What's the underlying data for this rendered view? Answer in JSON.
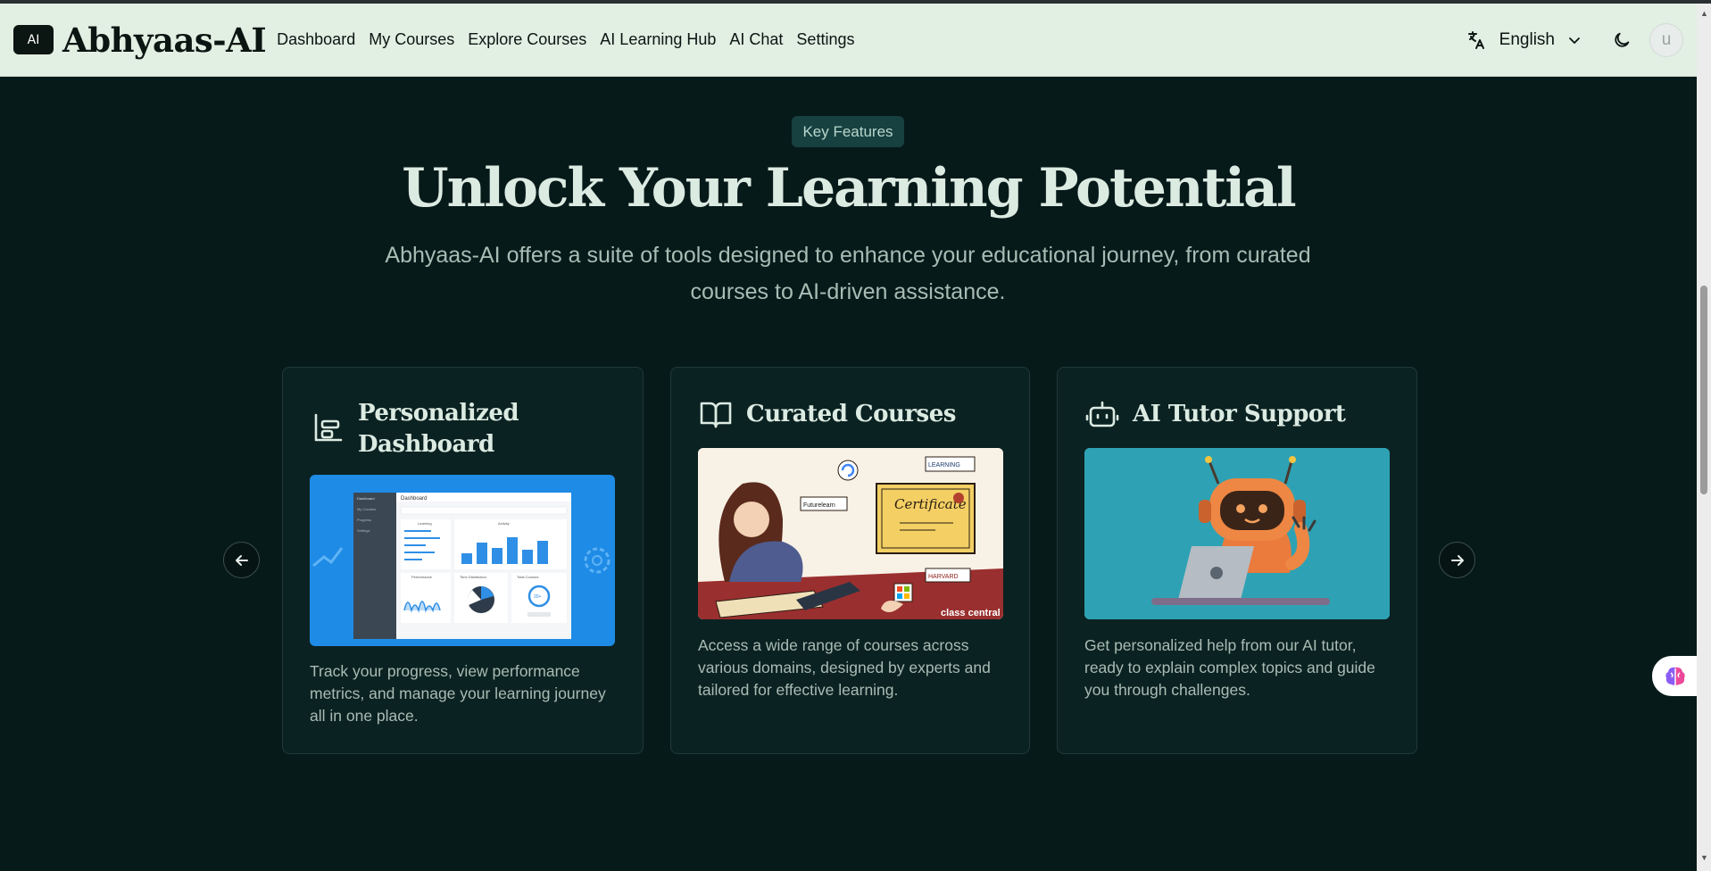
{
  "header": {
    "logo_badge": "AI",
    "brand": "Abhyaas-AI",
    "nav": [
      "Dashboard",
      "My Courses",
      "Explore Courses",
      "AI Learning Hub",
      "AI Chat",
      "Settings"
    ],
    "language": "English",
    "avatar_initial": "u"
  },
  "hero": {
    "badge": "Key Features",
    "title": "Unlock Your Learning Potential",
    "subtitle": "Abhyaas-AI offers a suite of tools designed to enhance your educational journey, from curated courses to AI-driven assistance."
  },
  "cards": [
    {
      "title": "Personalized Dashboard",
      "icon": "dashboard-layout-icon",
      "description": "Track your progress, view performance metrics, and manage your learning journey all in one place.",
      "image": {
        "header": "Dashboard",
        "sidebar_items": [
          "Dashboard",
          "My Courses",
          "Progress",
          "Settings"
        ],
        "widgets": [
          "Learning",
          "Activity",
          "Performance",
          "Time Distribution",
          "Total Courses"
        ],
        "stat": "20+"
      }
    },
    {
      "title": "Curated Courses",
      "icon": "book-open-icon",
      "description": "Access a wide range of courses across various domains, designed by experts and tailored for effective learning.",
      "image": {
        "certificate": "Certificate",
        "logos": [
          "LEARNING",
          "Futurelearn",
          "HARVARD",
          "class central"
        ]
      }
    },
    {
      "title": "AI Tutor Support",
      "icon": "bot-icon",
      "description": "Get personalized help from our AI tutor, ready to explain complex topics and guide you through challenges.",
      "image": {}
    }
  ],
  "colors": {
    "background": "#071a1a",
    "navbar": "#e2efe3",
    "card": "#0b2222",
    "badge": "#174040",
    "dashboard_image_bg": "#1e8be6",
    "tutor_image_bg": "#2ea2b4"
  }
}
